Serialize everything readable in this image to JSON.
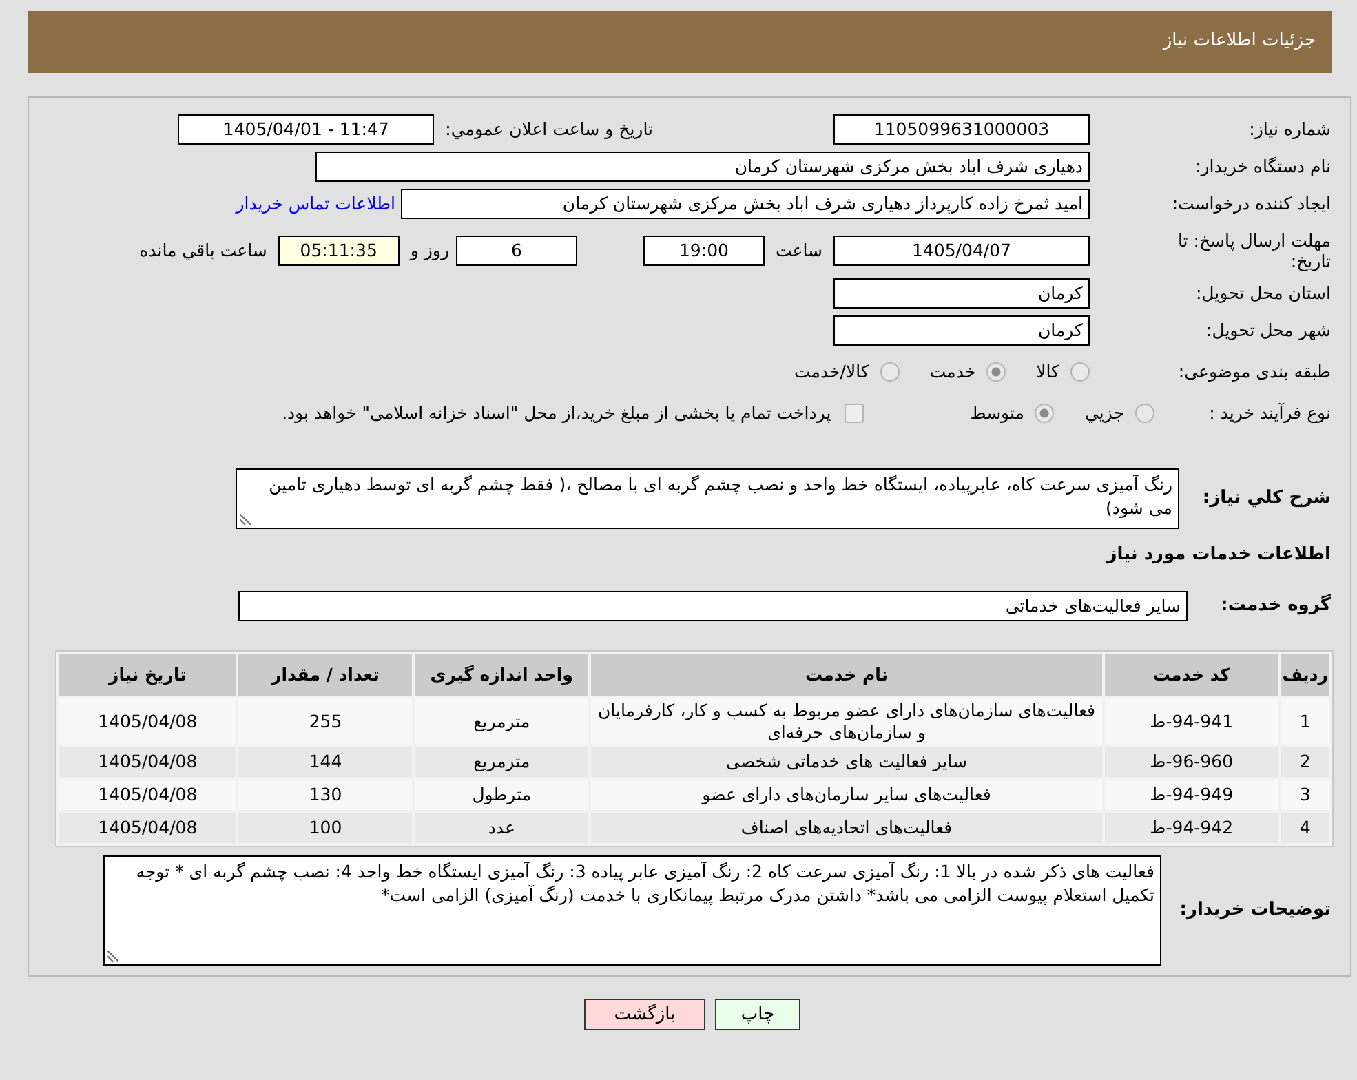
{
  "header": {
    "title": "جزئیات اطلاعات نیاز"
  },
  "need_number": {
    "label": "شماره نیاز:",
    "value": "1105099631000003"
  },
  "announce_datetime": {
    "label": "تاريخ و ساعت اعلان عمومي:",
    "value": "1405/04/01 - 11:47"
  },
  "buyer_org": {
    "label": "نام دستگاه خريدار:",
    "value": "دهیاری شرف اباد بخش مرکزی شهرستان کرمان"
  },
  "requester": {
    "label": "ايجاد کننده درخواست:",
    "value": "امید ثمرخ زاده کارپرداز دهیاری شرف اباد بخش مرکزی شهرستان کرمان",
    "contact_link": "اطلاعات تماس خريدار"
  },
  "deadline": {
    "label": "مهلت ارسال پاسخ: تا تاریخ:",
    "date": "1405/04/07",
    "time_label": "ساعت",
    "time": "19:00",
    "days": "6",
    "days_label": "روز و",
    "remaining": "05:11:35",
    "remaining_label": "ساعت باقي مانده"
  },
  "delivery_province": {
    "label": "استان محل تحويل:",
    "value": "کرمان"
  },
  "delivery_city": {
    "label": "شهر محل تحويل:",
    "value": "کرمان"
  },
  "category": {
    "label": "طبقه بندی موضوعی:",
    "options": [
      {
        "label": "کالا",
        "selected": false
      },
      {
        "label": "خدمت",
        "selected": true
      },
      {
        "label": "کالا/خدمت",
        "selected": false
      }
    ]
  },
  "purchase_process": {
    "label": "نوع فرآيند خريد :",
    "options": [
      {
        "label": "جزيي",
        "selected": false
      },
      {
        "label": "متوسط",
        "selected": true
      }
    ],
    "treasury_payment": {
      "checked": false,
      "label": "پرداخت تمام يا بخشی از مبلغ خرید،از محل \"اسناد خزانه اسلامی\" خواهد بود."
    }
  },
  "description": {
    "label": "شرح کلي نياز:",
    "value": "رنگ آمیزی سرعت کاه، عابرپیاده، ایستگاه خط واحد و نصب چشم گربه ای با مصالح ،( فقط چشم گربه ای توسط دهیاری تامین می شود)"
  },
  "services_heading": "اطلاعات خدمات مورد نياز",
  "service_group": {
    "label": "گروه خدمت:",
    "value": "سایر فعالیت‌های خدماتی"
  },
  "table": {
    "columns": [
      "ردیف",
      "کد خدمت",
      "نام خدمت",
      "واحد اندازه گیری",
      "تعداد / مقدار",
      "تاریخ نیاز"
    ],
    "rows": [
      [
        "1",
        "ط-94-941",
        "فعالیت‌های سازمان‌های دارای عضو مربوط به کسب و کار، کارفرمایان و سازمان‌های حرفه‌ای",
        "مترمربع",
        "255",
        "1405/04/08"
      ],
      [
        "2",
        "ط-96-960",
        "سایر فعالیت های خدماتی شخصی",
        "مترمربع",
        "144",
        "1405/04/08"
      ],
      [
        "3",
        "ط-94-949",
        "فعالیت‌های سایر سازمان‌های دارای عضو",
        "مترطول",
        "130",
        "1405/04/08"
      ],
      [
        "4",
        "ط-94-942",
        "فعالیت‌های اتحادیه‌های اصناف",
        "عدد",
        "100",
        "1405/04/08"
      ]
    ]
  },
  "buyer_notes": {
    "label": "توضیحات خريدار:",
    "value": "فعالیت های ذکر شده در بالا 1: رنگ آمیزی سرعت کاه 2: رنگ آمیزی عابر پیاده 3: رنگ آمیزی ایستگاه خط واحد 4: نصب چشم گربه ای * توجه تکمیل استعلام پیوست الزامی می باشد* داشتن مدرک مرتبط پیمانکاری با خدمت (رنگ آمیزی) الزامی است*"
  },
  "buttons": [
    {
      "label": "چاپ",
      "kind": "print"
    },
    {
      "label": "بازگشت",
      "kind": "back"
    }
  ]
}
